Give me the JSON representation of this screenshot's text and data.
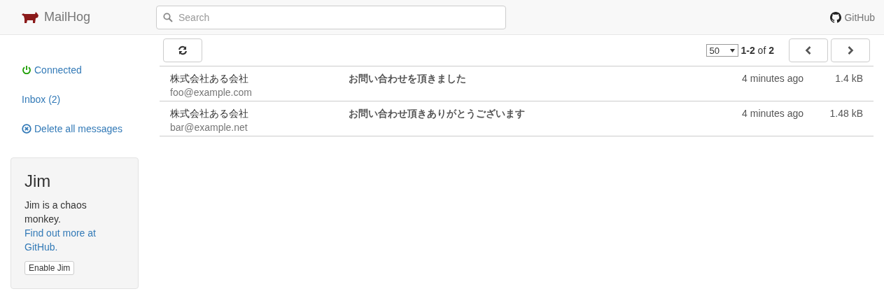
{
  "app": {
    "name": "MailHog"
  },
  "search": {
    "placeholder": "Search"
  },
  "nav_link": {
    "label": "GitHub"
  },
  "sidebar": {
    "connection": {
      "label": "Connected",
      "connected": true
    },
    "inbox": {
      "label": "Inbox (2)"
    },
    "delete_all": {
      "label": "Delete all messages"
    }
  },
  "jim": {
    "title": "Jim",
    "description": "Jim is a chaos monkey.",
    "link": "Find out more at GitHub.",
    "button": "Enable Jim"
  },
  "toolbar": {
    "page_size": "50",
    "range": "**1-2** of **2**"
  },
  "messages": [
    {
      "from": "株式会社ある会社",
      "email": "foo@example.com",
      "subject": "お問い合わせを頂きました",
      "time": "4 minutes ago",
      "size": "1.4 kB"
    },
    {
      "from": "株式会社ある会社",
      "email": "bar@example.net",
      "subject": "お問い合わせ頂きありがとうございます",
      "time": "4 minutes ago",
      "size": "1.48 kB"
    }
  ]
}
